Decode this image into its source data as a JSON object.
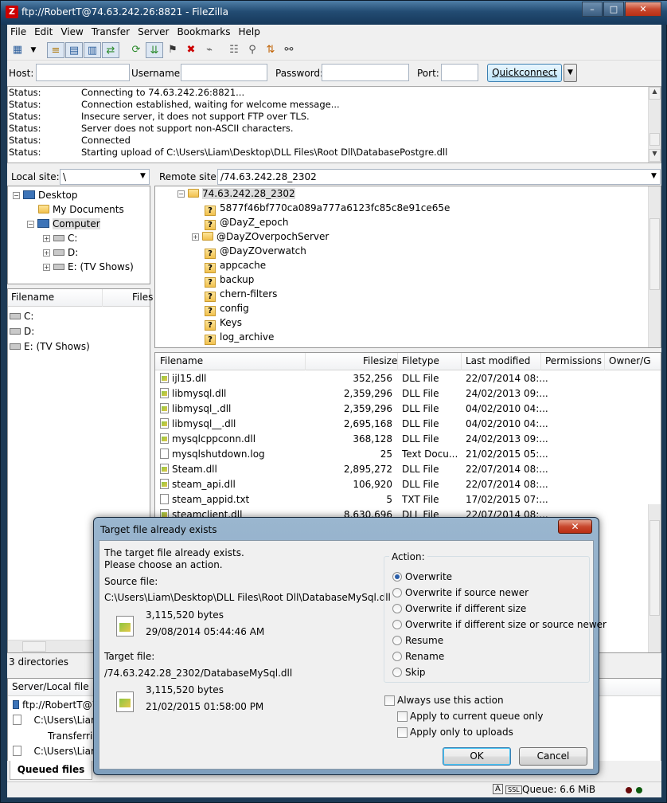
{
  "window": {
    "title": "ftp://RobertT@74.63.242.26:8821 - FileZilla",
    "app_icon": "filezilla-icon",
    "min": "–",
    "max": "□",
    "close": "✕"
  },
  "menu": [
    "File",
    "Edit",
    "View",
    "Transfer",
    "Server",
    "Bookmarks",
    "Help"
  ],
  "quickconnect": {
    "host_label": "Host:",
    "host_value": "",
    "username_label": "Username:",
    "username_value": "",
    "password_label": "Password:",
    "password_value": "",
    "port_label": "Port:",
    "port_value": "",
    "button": "Quickconnect"
  },
  "log": [
    {
      "k": "Status:",
      "v": "Connecting to 74.63.242.26:8821..."
    },
    {
      "k": "Status:",
      "v": "Connection established, waiting for welcome message..."
    },
    {
      "k": "Status:",
      "v": "Insecure server, it does not support FTP over TLS."
    },
    {
      "k": "Status:",
      "v": "Server does not support non-ASCII characters."
    },
    {
      "k": "Status:",
      "v": "Connected"
    },
    {
      "k": "Status:",
      "v": "Starting upload of C:\\Users\\Liam\\Desktop\\DLL Files\\Root Dll\\DatabasePostgre.dll"
    }
  ],
  "local": {
    "site_label": "Local site:",
    "site_value": "\\",
    "tree": [
      "Desktop",
      "My Documents",
      "Computer",
      "C:",
      "D:",
      "E: (TV Shows)"
    ],
    "col_filename": "Filename",
    "col_files": "Files",
    "files": [
      "C:",
      "D:",
      "E: (TV Shows)"
    ],
    "status": "3 directories"
  },
  "remote": {
    "site_label": "Remote site:",
    "site_value": "/74.63.242.28_2302",
    "tree_root": "74.63.242.28_2302",
    "tree": [
      "5877f46bf770ca089a777a6123fc85c8e91ce65e",
      "@DayZ_epoch",
      "@DayZOverpochServer",
      "@DayZOverwatch",
      "appcache",
      "backup",
      "chern-filters",
      "config",
      "Keys",
      "log_archive"
    ],
    "columns": [
      "Filename",
      "Filesize",
      "Filetype",
      "Last modified",
      "Permissions",
      "Owner/G"
    ],
    "files": [
      {
        "name": "ijl15.dll",
        "size": "352,256",
        "type": "DLL File",
        "modified": "22/07/2014 08:..."
      },
      {
        "name": "libmysql.dll",
        "size": "2,359,296",
        "type": "DLL File",
        "modified": "24/02/2013 09:..."
      },
      {
        "name": "libmysql_.dll",
        "size": "2,359,296",
        "type": "DLL File",
        "modified": "04/02/2010 04:..."
      },
      {
        "name": "libmysql__.dll",
        "size": "2,695,168",
        "type": "DLL File",
        "modified": "04/02/2010 04:..."
      },
      {
        "name": "mysqlcppconn.dll",
        "size": "368,128",
        "type": "DLL File",
        "modified": "24/02/2013 09:..."
      },
      {
        "name": "mysqlshutdown.log",
        "size": "25",
        "type": "Text Docu...",
        "modified": "21/02/2015 05:..."
      },
      {
        "name": "Steam.dll",
        "size": "2,895,272",
        "type": "DLL File",
        "modified": "22/07/2014 08:..."
      },
      {
        "name": "steam_api.dll",
        "size": "106,920",
        "type": "DLL File",
        "modified": "22/07/2014 08:..."
      },
      {
        "name": "steam_appid.txt",
        "size": "5",
        "type": "TXT File",
        "modified": "17/02/2015 07:..."
      },
      {
        "name": "steamclient.dll",
        "size": "8,630,696",
        "type": "DLL File",
        "modified": "22/07/2014 08:..."
      }
    ]
  },
  "queue": {
    "col_server_local": "Server/Local file",
    "rows": [
      "ftp://RobertT@7",
      "C:\\Users\\Liam",
      "Transferrin",
      "C:\\Users\\Liam"
    ],
    "tab": "Queued files (5)",
    "status": "Queue: 6.6 MiB"
  },
  "dialog": {
    "title": "Target file already exists",
    "close": "✕",
    "message1": "The target file already exists.",
    "message2": "Please choose an action.",
    "source_label": "Source file:",
    "source_path": "C:\\Users\\Liam\\Desktop\\DLL Files\\Root Dll\\DatabaseMySql.dll",
    "source_size": "3,115,520 bytes",
    "source_date": "29/08/2014 05:44:46 AM",
    "target_label": "Target file:",
    "target_path": "/74.63.242.28_2302/DatabaseMySql.dll",
    "target_size": "3,115,520 bytes",
    "target_date": "21/02/2015 01:58:00 PM",
    "action_label": "Action:",
    "actions": [
      "Overwrite",
      "Overwrite if source newer",
      "Overwrite if different size",
      "Overwrite if different size or source newer",
      "Resume",
      "Rename",
      "Skip"
    ],
    "selected_action": "Overwrite",
    "always": "Always use this action",
    "current_queue": "Apply to current queue only",
    "uploads_only": "Apply only to uploads",
    "ok": "OK",
    "cancel": "Cancel"
  }
}
